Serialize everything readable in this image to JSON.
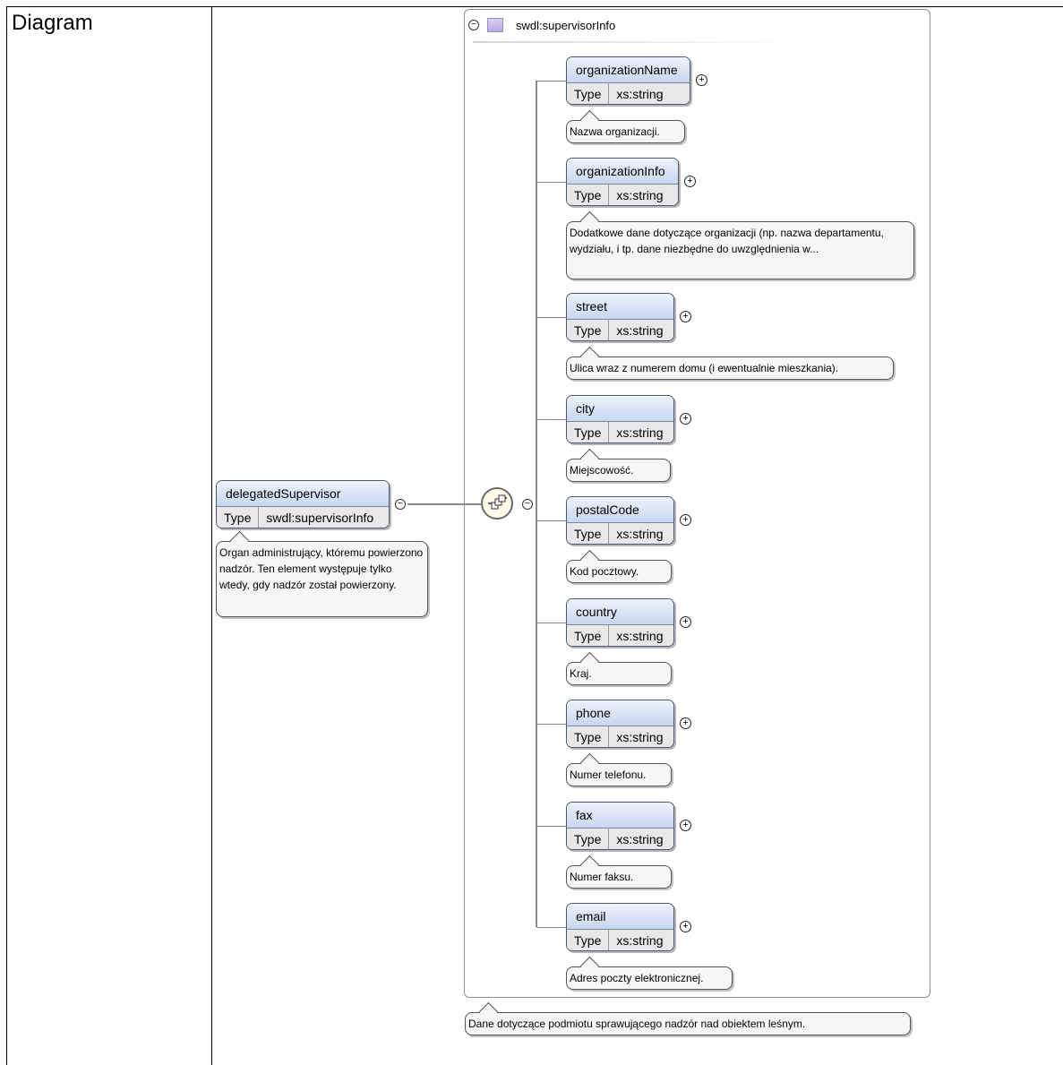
{
  "row_label": "Diagram",
  "complex_type": {
    "name": "swdl:supervisorInfo",
    "annotation": "Dane dotyczące podmiotu sprawującego nadzór nad obiektem leśnym."
  },
  "root": {
    "name": "delegatedSupervisor",
    "type_key": "Type",
    "type_value": "swdl:supervisorInfo",
    "annotation": "Organ administrujący, któremu powierzono nadzór. Ten element występuje tylko wtedy, gdy nadzór został powierzony."
  },
  "children": [
    {
      "name": "organizationName",
      "type_key": "Type",
      "type_value": "xs:string",
      "annotation": "Nazwa organizacji."
    },
    {
      "name": "organizationInfo",
      "type_key": "Type",
      "type_value": "xs:string",
      "annotation": "Dodatkowe dane dotyczące organizacji (np. nazwa departamentu, wydziału, i tp. dane niezbędne do uwzględnienia w..."
    },
    {
      "name": "street",
      "type_key": "Type",
      "type_value": "xs:string",
      "annotation": "Ulica wraz z numerem domu (i ewentualnie mieszkania)."
    },
    {
      "name": "city",
      "type_key": "Type",
      "type_value": "xs:string",
      "annotation": "Miejscowość."
    },
    {
      "name": "postalCode",
      "type_key": "Type",
      "type_value": "xs:string",
      "annotation": "Kod pocztowy."
    },
    {
      "name": "country",
      "type_key": "Type",
      "type_value": "xs:string",
      "annotation": "Kraj."
    },
    {
      "name": "phone",
      "type_key": "Type",
      "type_value": "xs:string",
      "annotation": "Numer telefonu."
    },
    {
      "name": "fax",
      "type_key": "Type",
      "type_value": "xs:string",
      "annotation": "Numer faksu."
    },
    {
      "name": "email",
      "type_key": "Type",
      "type_value": "xs:string",
      "annotation": "Adres poczty elektronicznej."
    }
  ],
  "icons": {
    "collapse": "collapse-minus-icon",
    "expand": "expand-plus-icon",
    "sequence": "sequence-compositor-icon",
    "type": "complex-type-icon"
  }
}
